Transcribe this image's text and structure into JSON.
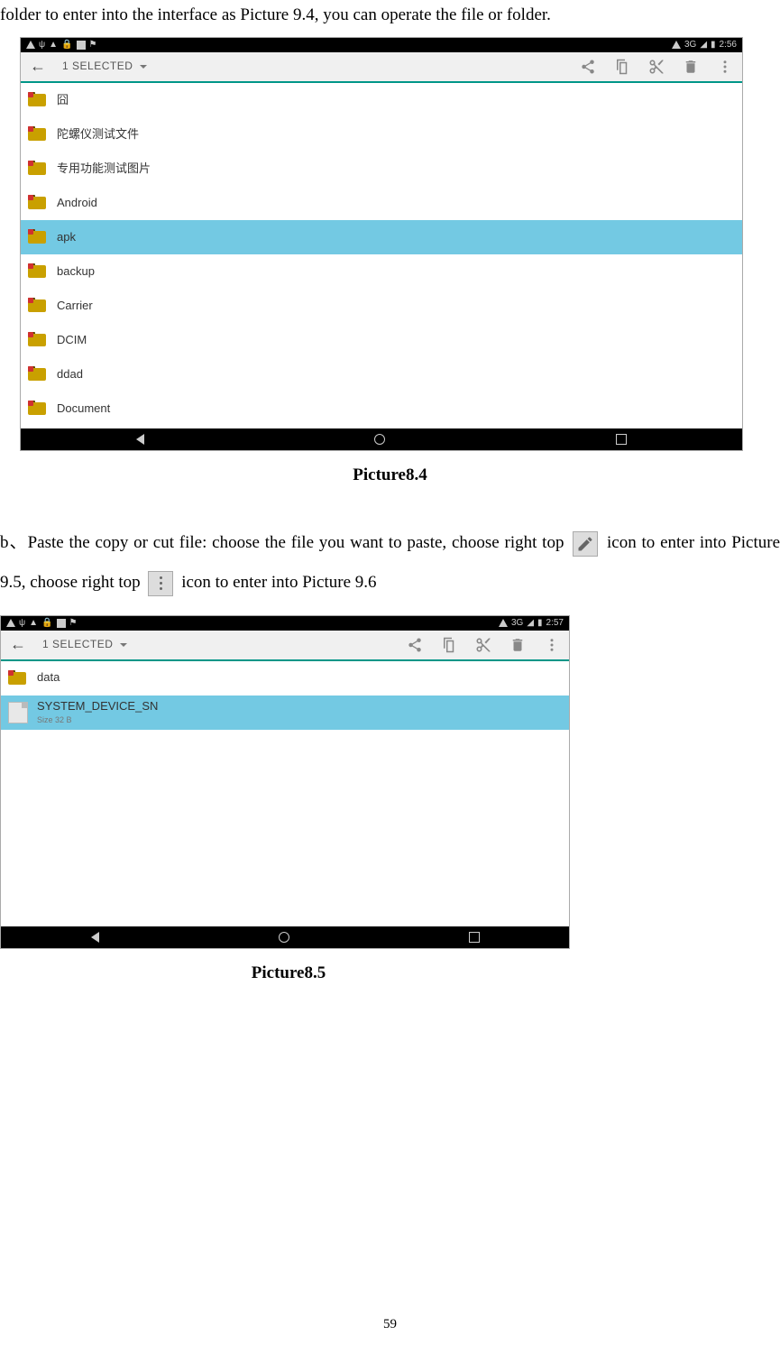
{
  "intro": "folder to enter into the interface as Picture 9.4, you can operate the file or folder.",
  "status": {
    "left_icons": [
      "▼",
      "ψ",
      "▲",
      "🔒",
      "■",
      "📋"
    ],
    "signal": "3G",
    "battery": "▮",
    "time1": "2:56",
    "time2": "2:57"
  },
  "selection_bar": {
    "title": "1 SELECTED"
  },
  "screenshot1": {
    "folders": [
      {
        "name": "囧",
        "selected": false
      },
      {
        "name": "陀螺仪测试文件",
        "selected": false
      },
      {
        "name": "专用功能测试图片",
        "selected": false
      },
      {
        "name": "Android",
        "selected": false
      },
      {
        "name": "apk",
        "selected": true
      },
      {
        "name": "backup",
        "selected": false
      },
      {
        "name": "Carrier",
        "selected": false
      },
      {
        "name": "DCIM",
        "selected": false
      },
      {
        "name": "ddad",
        "selected": false
      },
      {
        "name": "Document",
        "selected": false
      }
    ]
  },
  "caption1": "Picture8.4",
  "para_b_1": "b、Paste the copy or cut file: choose the file you want to paste, choose right top ",
  "para_b_2": " icon to enter into Picture 9.5, choose right top ",
  "para_b_3": " icon to enter into Picture 9.6",
  "screenshot2": {
    "items": [
      {
        "type": "folder",
        "name": "data",
        "selected": false
      },
      {
        "type": "file",
        "name": "SYSTEM_DEVICE_SN",
        "size": "Size 32 B",
        "selected": true
      }
    ]
  },
  "caption2": "Picture8.5",
  "page_number": "59"
}
